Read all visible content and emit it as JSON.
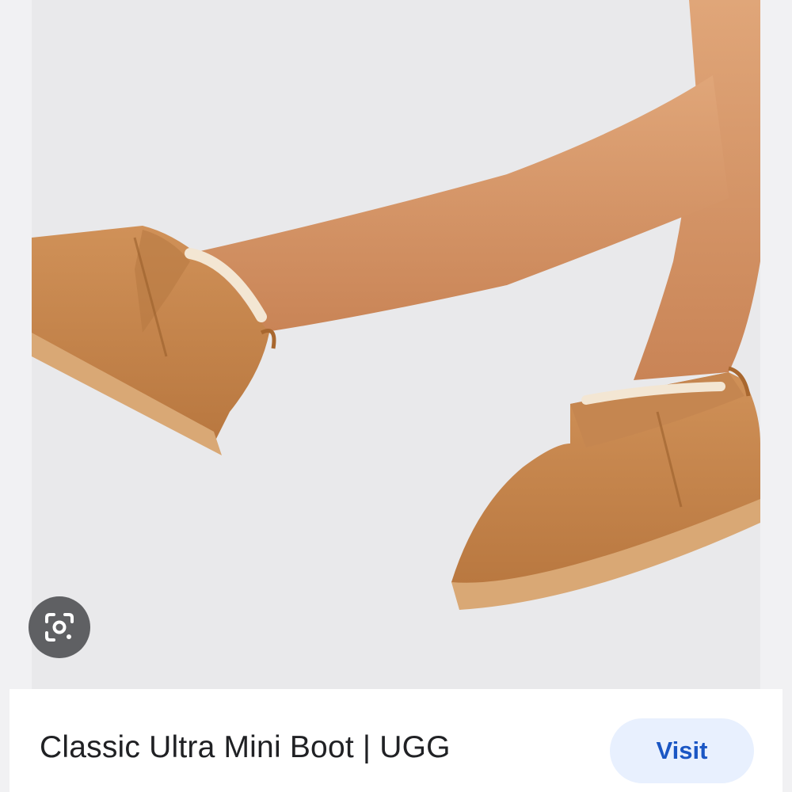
{
  "result": {
    "title": "Classic Ultra Mini Boot | UGG",
    "visit_label": "Visit"
  },
  "image": {
    "subject": "legs wearing chestnut suede ultra mini boots",
    "colors": {
      "background": "#e9e9eb",
      "suede": "#c98a52",
      "suede_shadow": "#a96b37",
      "sole": "#d7a26f",
      "skin": "#d79a6e",
      "fur": "#f3e6d3"
    }
  },
  "icons": {
    "lens": "google-lens-icon"
  },
  "colors": {
    "visit_bg": "#e8f0fe",
    "visit_text": "#1a56c4",
    "title_text": "#202124"
  }
}
